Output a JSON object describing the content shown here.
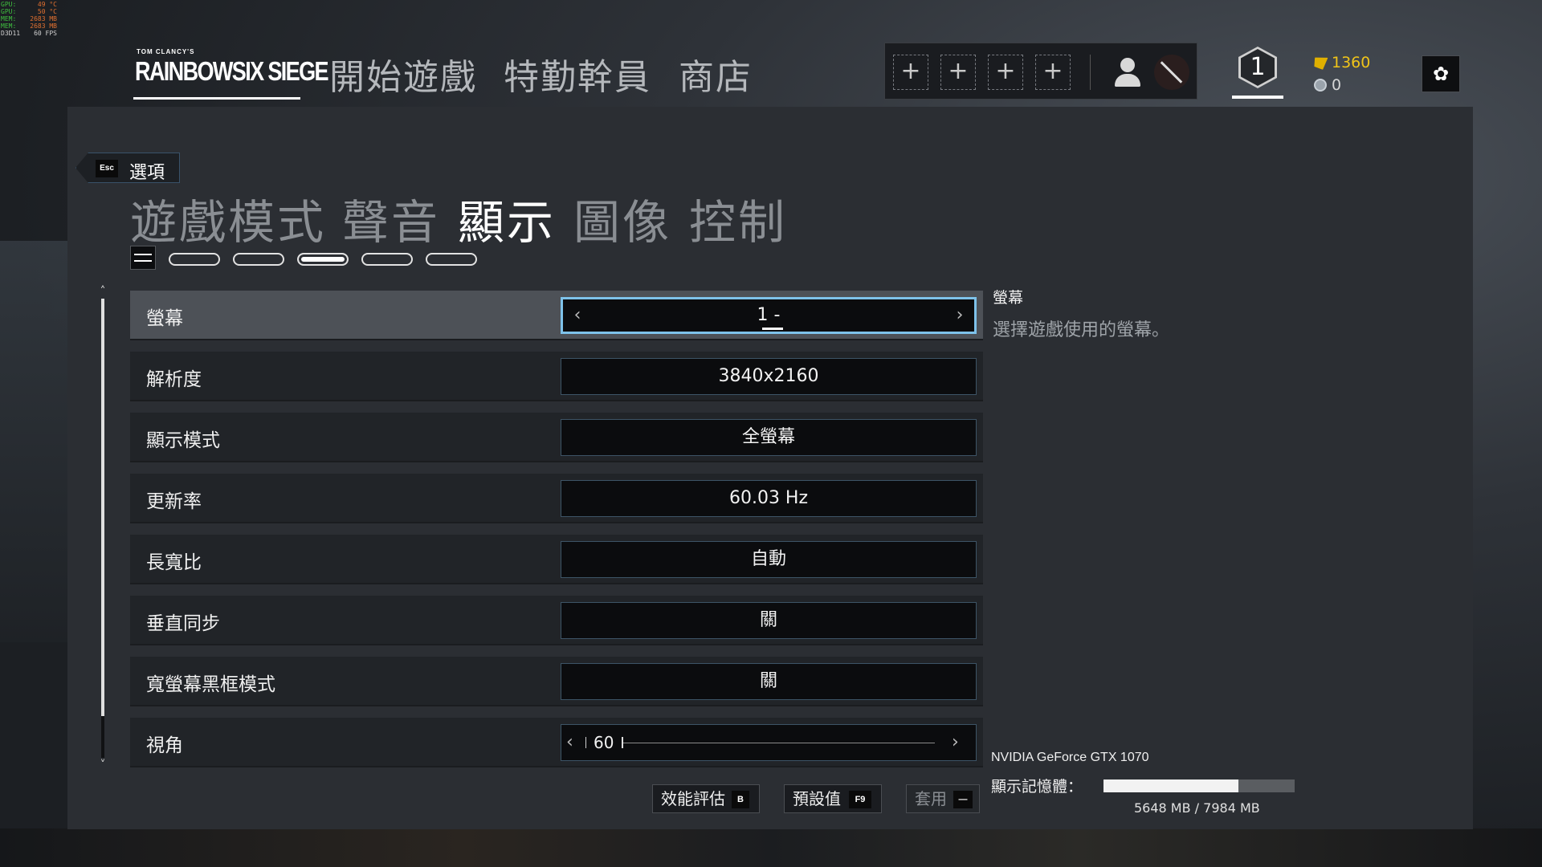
{
  "fps_overlay": {
    "rows": [
      {
        "k": "GPU:",
        "v": "49 °C"
      },
      {
        "k": "GPU:",
        "v": "50 °C"
      },
      {
        "k": "MEM:",
        "v": "2683 MB"
      },
      {
        "k": "MEM:",
        "v": "2683 MB"
      },
      {
        "k": "D3D11",
        "v": "60 FPS"
      }
    ]
  },
  "topnav": {
    "logo_small": "TOM CLANCY'S",
    "logo_main": "RAINBOWSIX SIEGE",
    "items": [
      "開始遊戲",
      "特勤幹員",
      "商店"
    ],
    "squad_slots": [
      "+",
      "+",
      "+",
      "+"
    ],
    "rank": "1",
    "renown": "1360",
    "credits": "0",
    "settings_icon": "✿"
  },
  "options": {
    "esc_key": "Esc",
    "back_label": "選項",
    "tabs": [
      "遊戲模式",
      "聲音",
      "顯示",
      "圖像",
      "控制"
    ],
    "active_tab_index": 2
  },
  "settings": [
    {
      "label": "螢幕",
      "value": "1 -",
      "selected": true
    },
    {
      "label": "解析度",
      "value": "3840x2160"
    },
    {
      "label": "顯示模式",
      "value": "全螢幕"
    },
    {
      "label": "更新率",
      "value": "60.03 Hz"
    },
    {
      "label": "長寬比",
      "value": "自動"
    },
    {
      "label": "垂直同步",
      "value": "關"
    },
    {
      "label": "寬螢幕黑框模式",
      "value": "關"
    },
    {
      "label": "視角",
      "value": "60"
    }
  ],
  "description": {
    "title": "螢幕",
    "text": "選擇遊戲使用的螢幕。"
  },
  "bottom_buttons": {
    "benchmark_label": "效能評估",
    "benchmark_key": "B",
    "default_label": "預設值",
    "default_key": "F9",
    "apply_label": "套用",
    "apply_key": "—"
  },
  "gpu": {
    "name": "NVIDIA GeForce GTX 1070",
    "vram_label": "顯示記憶體：",
    "vram_text": "5648 MB / 7984 MB",
    "vram_fraction": 0.707
  }
}
